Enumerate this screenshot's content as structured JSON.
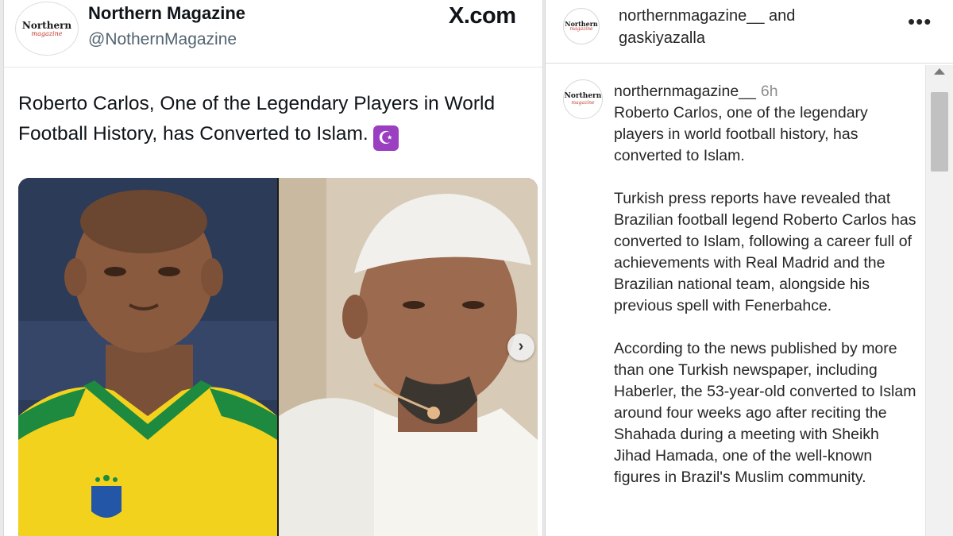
{
  "tweet": {
    "avatar_logo": {
      "top": "Northern",
      "bottom": "magazine"
    },
    "account_name": "Northern Magazine",
    "handle": "@NothernMagazine",
    "source_label": "X.com",
    "text": "Roberto Carlos, One of the Legendary Players in World Football History, has Converted to Islam.",
    "emoji": "☪",
    "media": {
      "next_arrow": "›"
    }
  },
  "instagram": {
    "header": {
      "avatar_logo": {
        "top": "Northern",
        "bottom": "magazine"
      },
      "usernames": "northernmagazine__ and",
      "collaborator": "gaskiyazalla",
      "more": "•••"
    },
    "post": {
      "avatar_logo": {
        "top": "Northern",
        "bottom": "magazine"
      },
      "username": "northernmagazine__",
      "time": "6h",
      "caption_lead": "Roberto Carlos, one of the legendary players in world football history, has converted to Islam.",
      "paragraph_2": "Turkish press reports have revealed that Brazilian football legend Roberto Carlos has converted to Islam, following a career full of achievements with Real Madrid and the Brazilian national team, alongside his previous spell with Fenerbahce.",
      "paragraph_3": "According to the news published by more than one Turkish newspaper, including Haberler, the 53-year-old converted to Islam around four weeks ago after reciting the Shahada during a meeting with Sheikh Jihad Hamada, one of the well-known figures in Brazil's Muslim community."
    }
  }
}
